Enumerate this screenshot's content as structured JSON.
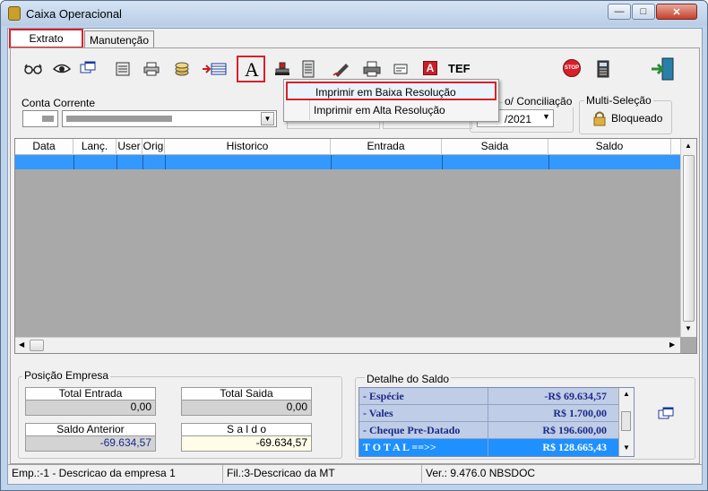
{
  "window": {
    "title": "Caixa Operacional",
    "controls": [
      "minimize-icon",
      "maximize-icon",
      "close-icon"
    ]
  },
  "tabs": [
    {
      "label": "Extrato",
      "active": true
    },
    {
      "label": "Manutenção",
      "active": false
    }
  ],
  "toolbar": {
    "icons": [
      "glasses-icon",
      "eye-icon",
      "windows-icon",
      "calculator-grid-icon",
      "printer-icon",
      "coin-stack-icon",
      "card-icon",
      "font-a-icon",
      "stamp-icon",
      "server-icon",
      "pen-sign-icon",
      "print-alt-icon",
      "card-reader-icon",
      "red-a-icon",
      "stop-sign-icon",
      "calculator-icon",
      "exit-door-icon"
    ],
    "tef_label": "TEF",
    "font_letter": "A",
    "red_letter": "A",
    "stop_label": "STOP"
  },
  "print_menu": {
    "items": [
      "Imprimir em Baixa Resolução",
      "Imprimir em Alta Resolução"
    ]
  },
  "account": {
    "label": "Conta Corrente",
    "period_label": "o/ Conciliação",
    "period_value": "/2021"
  },
  "multi_select": {
    "label": "Multi-Seleção",
    "button_label": "Bloqueado"
  },
  "grid": {
    "columns": [
      "Data",
      "Lanç.",
      "User",
      "Orig",
      "Historico",
      "Entrada",
      "Saida",
      "Saldo"
    ]
  },
  "position": {
    "label": "Posição Empresa",
    "total_entrada_label": "Total Entrada",
    "total_entrada_value": "0,00",
    "total_saida_label": "Total Saida",
    "total_saida_value": "0,00",
    "saldo_anterior_label": "Saldo Anterior",
    "saldo_anterior_value": "-69.634,57",
    "saldo_label": "S a l d o",
    "saldo_value": "-69.634,57"
  },
  "balance_detail": {
    "label": "Detalhe do Saldo",
    "rows": [
      {
        "label": "- Espécie",
        "value": "-R$ 69.634,57"
      },
      {
        "label": "- Vales",
        "value": "R$ 1.700,00"
      },
      {
        "label": "- Cheque Pre-Datado",
        "value": "R$ 196.600,00"
      }
    ],
    "total_label": "T O T A L ==>>",
    "total_value": "R$ 128.665,43"
  },
  "status_bar": {
    "empresa": "Emp.:-1 - Descricao da empresa 1",
    "filial": "Fil.:3-Descricao da MT",
    "version": "Ver.: 9.476.0  NBSDOC"
  },
  "colors": {
    "highlight": "#d8202a",
    "selection_row": "#3399ff",
    "grid_bg": "#a9a9a9",
    "total_row_bg": "#1e90ff",
    "detail_bg": "#c0cde6",
    "detail_text": "#1a2a8a"
  }
}
